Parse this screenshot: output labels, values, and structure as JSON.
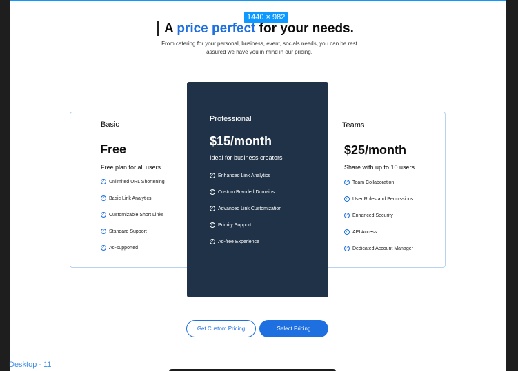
{
  "canvas": {
    "frame_label": "Desktop - 11",
    "dimensions_badge": "1440 × 982"
  },
  "hero": {
    "title_prefix": "A",
    "title_accent": "price perfect",
    "title_suffix": "for your needs.",
    "subtitle": "From catering for your personal, business, event, socials needs, you can be rest assured we have you in mind in our pricing."
  },
  "plans": [
    {
      "name": "Basic",
      "price": "Free",
      "description": "Free plan for all users",
      "features": [
        "Unlimited URL Shortening",
        "Basic Link Analytics",
        "Customizable Short Links",
        "Standard Support",
        "Ad-supported"
      ]
    },
    {
      "name": "Professional",
      "price": "$15/month",
      "description": "Ideal for business creators",
      "features": [
        "Enhanced Link Analytics",
        "Custom Branded Domains",
        "Advanced Link Customization",
        "Priority Support",
        "Ad-free Experience"
      ]
    },
    {
      "name": "Teams",
      "price": "$25/month",
      "description": "Share with up to 10 users",
      "features": [
        "Team Collaboration",
        "User Roles and Permissions",
        "Enhanced Security",
        "API Access",
        "Dedicated Account Manager"
      ]
    }
  ],
  "actions": {
    "custom_pricing": "Get Custom Pricing",
    "select_pricing": "Select Pricing"
  },
  "colors": {
    "accent": "#1e6fe0",
    "featured_card": "#1f3247",
    "selection_blue": "#0d99ff",
    "canvas_background": "#1e1e1e"
  },
  "icons": {
    "feature_bullet": "check-circle-icon"
  }
}
